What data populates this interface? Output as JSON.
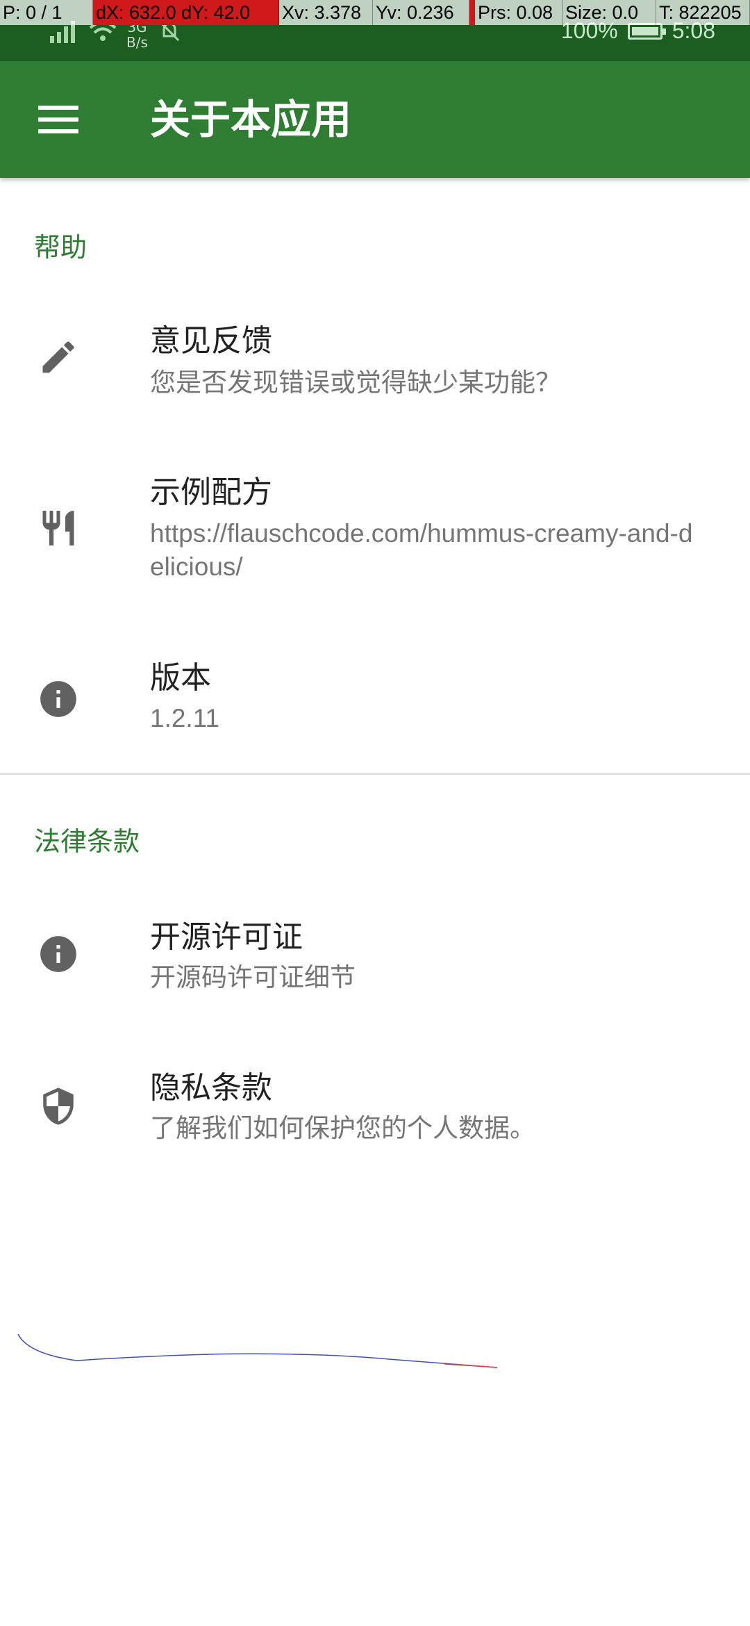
{
  "debug": {
    "pointer": "P: 0 / 1",
    "delta": "dX: 632.0 dY: 42.0",
    "xv": "Xv: 3.378",
    "yv": "Yv: 0.236",
    "pressure": "Prs: 0.08",
    "size": "Size: 0.0",
    "time": "T: 822205"
  },
  "status_bar": {
    "network_type": "3G",
    "speed_unit": "B/s",
    "battery_percent": "100%",
    "time": "5:08"
  },
  "app_bar": {
    "menu_icon": "menu-icon",
    "title": "关于本应用"
  },
  "sections": {
    "help": {
      "header": "帮助",
      "items": [
        {
          "icon": "pencil-icon",
          "title": "意见反馈",
          "subtitle": "您是否发现错误或觉得缺少某功能？"
        },
        {
          "icon": "cutlery-icon",
          "title": "示例配方",
          "subtitle": "https://flauschcode.com/hummus-creamy-and-delicious/"
        },
        {
          "icon": "info-icon",
          "title": "版本",
          "subtitle": "1.2.11"
        }
      ]
    },
    "legal": {
      "header": "法律条款",
      "items": [
        {
          "icon": "info-icon",
          "title": "开源许可证",
          "subtitle": "开源码许可证细节"
        },
        {
          "icon": "shield-icon",
          "title": "隐私条款",
          "subtitle": "了解我们如何保护您的个人数据。"
        }
      ]
    }
  },
  "colors": {
    "status_bar": "#1b5e20",
    "app_bar": "#2e7d32",
    "accent": "#2e7d32",
    "icon": "#616161"
  }
}
